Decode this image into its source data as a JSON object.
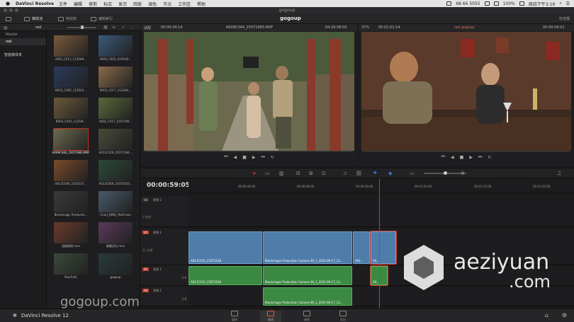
{
  "menubar": {
    "app_name": "DaVinci Resolve",
    "items": [
      "文件",
      "编辑",
      "修剪",
      "标志",
      "显示",
      "回放",
      "调色",
      "节点",
      "工作区",
      "帮助"
    ],
    "status": [
      "68 66 5055",
      "100%",
      "周四下午3:19"
    ]
  },
  "window_title": "gogoup",
  "toolbar": {
    "tabs": [
      {
        "label": "媒体池"
      },
      {
        "label": "特效库"
      },
      {
        "label": "编辑索引"
      }
    ],
    "project_title": "gogoup",
    "inspector_label": "检查器"
  },
  "media_pool": {
    "bin_root": "Master",
    "current_bin": "red",
    "bin_selected": "red",
    "smart_bins": "智能媒体夹",
    "clips": [
      {
        "label": "A001_C011_1120H0..."
      },
      {
        "label": "A004_C003_0101VD..."
      },
      {
        "label": "B001_C005_112624..."
      },
      {
        "label": "B003_C017_1123H4..."
      },
      {
        "label": "B003_C043_1125I9..."
      },
      {
        "label": "A002_C017_1507190..."
      },
      {
        "label": "A009C044_15071983.MXF",
        "selected": true
      },
      {
        "label": "A011C019_15072184..."
      },
      {
        "label": "A013C006_1410127..."
      },
      {
        "label": "A013C006_15072410..."
      },
      {
        "label": "Blackmagic Productio..."
      },
      {
        "label": "Chart_BMD_FILM.mov"
      },
      {
        "label": "固能跳橙.mov"
      },
      {
        "label": "最最坚矢.mov"
      },
      {
        "label": "Stan5at1"
      },
      {
        "label": "gogoup"
      }
    ],
    "watermark": "gogoup.com"
  },
  "source_viewer": {
    "zoom": "适配",
    "timecode_left": "00:00:34:14",
    "clip_name": "A009C044_15071983.MXF",
    "timecode_right": "04:29:58:00"
  },
  "timeline_viewer": {
    "zoom": "37%",
    "timecode_left": "00:01:01:14",
    "timeline_name": "red gogoup",
    "timecode_right": "00:00:59:01"
  },
  "timeline": {
    "timecode": "00:00:59:05",
    "ruler_ticks": [
      "00:00:40:00",
      "00:00:48:00",
      "00:00:56:00",
      "00:01:04:00",
      "00:01:12:00",
      "00:01:20:00"
    ],
    "tracks": [
      {
        "id": "V2",
        "name": "视频 2",
        "count": "0 剪辑"
      },
      {
        "id": "V1",
        "name": "视频 1",
        "count": "11 剪辑"
      },
      {
        "id": "A1",
        "name": "音频 1",
        "level": "1.0"
      },
      {
        "id": "A2",
        "name": "音频 2",
        "level": "1.0"
      }
    ],
    "video_clips": [
      {
        "label": "A011C019_15072184"
      },
      {
        "label": "Blackmagic Production Camera 4K_1_2015-06-17_12..."
      },
      {
        "label": "Blackmagic Production Camera 4K_1_2015-06-17_12..."
      },
      {
        "label": "A01..."
      },
      {
        "label": "A0..."
      }
    ],
    "audio_clips": [
      {
        "label": "A011C019_15072184"
      },
      {
        "label": "Blackmagic Production Camera 4K_1_2015-06-17_12..."
      },
      {
        "label": "A0..."
      }
    ],
    "audio2_clips": [
      {
        "label": "Blackmagic Production Camera 4K_1_2015-06-17_12..."
      }
    ]
  },
  "bottombar": {
    "app_label": "DaVinci Resolve 12",
    "pages": [
      {
        "label": "媒体"
      },
      {
        "label": "编辑"
      },
      {
        "label": "调色"
      },
      {
        "label": "导出"
      }
    ],
    "active_page": "编辑"
  },
  "watermark_logo": {
    "text1": "aeziyuan",
    "text2": ".com"
  },
  "colors": {
    "accent": "#d0362a",
    "video_clip": "#4e7daa",
    "audio_clip": "#3c8a42"
  }
}
